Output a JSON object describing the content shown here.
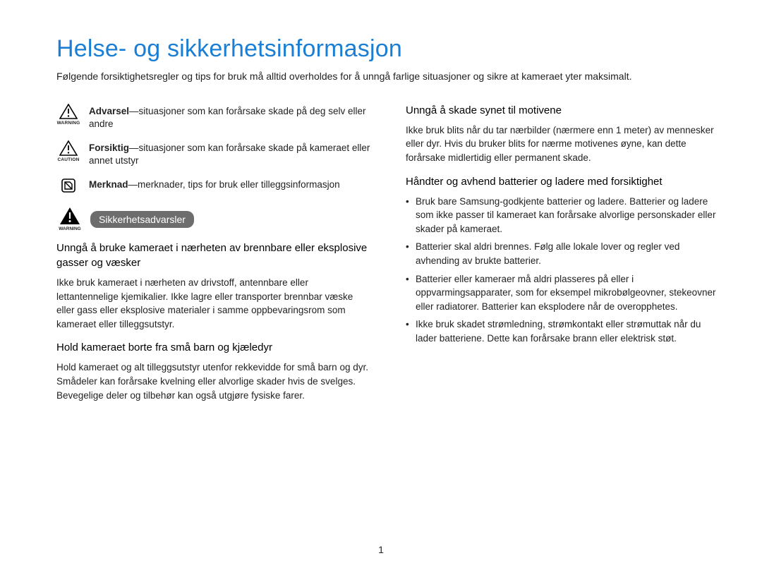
{
  "title": "Helse- og sikkerhetsinformasjon",
  "intro": "Følgende forsiktighetsregler og tips for bruk må alltid overholdes for å unngå farlige situasjoner og sikre at kameraet yter maksimalt.",
  "legend": {
    "warning": {
      "label": "Advarsel",
      "sep": "—",
      "desc": "situasjoner som kan forårsake skade på deg selv eller andre",
      "sub": "WARNING"
    },
    "caution": {
      "label": "Forsiktig",
      "sep": "—",
      "desc": "situasjoner som kan forårsake skade på kameraet eller annet utstyr",
      "sub": "CAUTION"
    },
    "note": {
      "label": "Merknad",
      "sep": "—",
      "desc": "merknader, tips for bruk eller tilleggsinformasjon"
    }
  },
  "badge": {
    "label": "Sikkerhetsadvarsler",
    "sub": "WARNING"
  },
  "left_sections": [
    {
      "heading": "Unngå å bruke kameraet i nærheten av brennbare eller eksplosive gasser og væsker",
      "body": "Ikke bruk kameraet i nærheten av drivstoff, antennbare eller lettantennelige kjemikalier. Ikke lagre eller transporter brennbar væske eller gass eller eksplosive materialer i samme oppbevaringsrom som kameraet eller tilleggsutstyr."
    },
    {
      "heading": "Hold kameraet borte fra små barn og kjæledyr",
      "body": "Hold kameraet og alt tilleggsutstyr utenfor rekkevidde for små barn og dyr. Smådeler kan forårsake kvelning eller alvorlige skader hvis de svelges. Bevegelige deler og tilbehør kan også utgjøre fysiske farer."
    }
  ],
  "right_sections": [
    {
      "heading": "Unngå å skade synet til motivene",
      "body": "Ikke bruk blits når du tar nærbilder (nærmere enn 1 meter) av mennesker eller dyr. Hvis du bruker blits for nærme motivenes øyne, kan dette forårsake midlertidig eller permanent skade."
    },
    {
      "heading": "Håndter og avhend batterier og ladere med forsiktighet",
      "bullets": [
        "Bruk bare Samsung-godkjente batterier og ladere. Batterier og ladere som ikke passer til kameraet kan forårsake alvorlige personskader eller skader på kameraet.",
        "Batterier skal aldri brennes. Følg alle lokale lover og regler ved avhending av brukte batterier.",
        "Batterier eller kameraer må aldri plasseres på eller i oppvarmingsapparater, som for eksempel mikrobølgeovner, stekeovner eller radiatorer. Batterier kan eksplodere når de overopphetes.",
        "Ikke bruk skadet strømledning, strømkontakt eller strømuttak når du lader batteriene. Dette kan forårsake brann eller elektrisk støt."
      ]
    }
  ],
  "page_number": "1"
}
